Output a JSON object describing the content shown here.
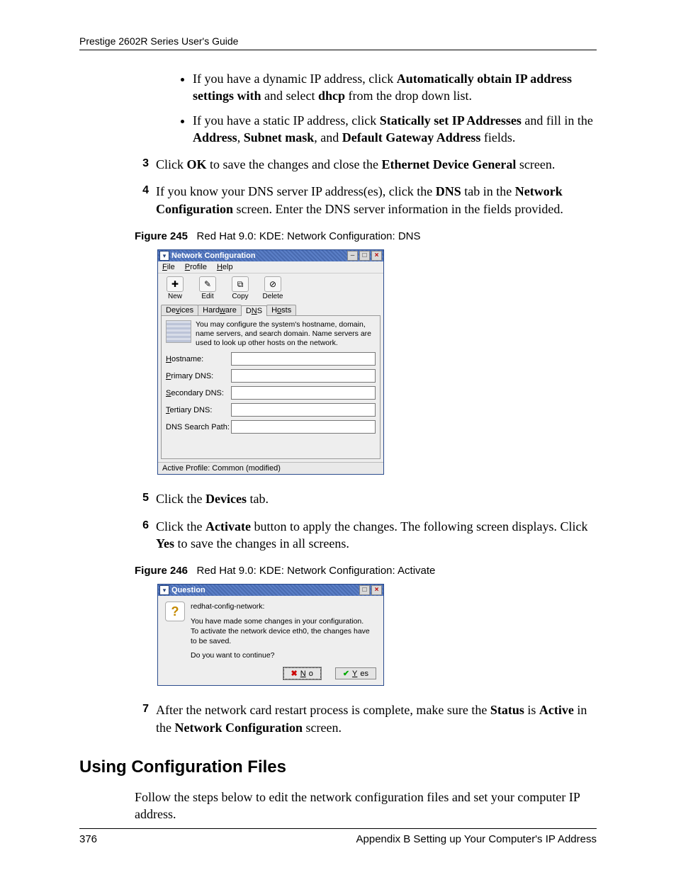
{
  "doc": {
    "header": "Prestige 2602R Series User's Guide",
    "footer_left": "376",
    "footer_right": "Appendix B Setting up Your Computer's IP Address"
  },
  "bullets": {
    "b1": {
      "pre": "If you have a dynamic IP address, click ",
      "b1": "Automatically obtain IP address settings with",
      "mid": " and select ",
      "b2": "dhcp",
      "post": " from the drop down list."
    },
    "b2": {
      "pre": "If you have a static IP address, click ",
      "b1": "Statically set IP Addresses",
      "mid": " and fill in the ",
      "b2": "Address",
      "c": ", ",
      "b3": "Subnet mask",
      "c2": ", and ",
      "b4": "Default Gateway Address",
      "post": " fields."
    }
  },
  "steps": {
    "s3": {
      "n": "3",
      "pre": "Click ",
      "b1": "OK",
      "mid": " to save the changes and close the ",
      "b2": "Ethernet Device General",
      "post": " screen."
    },
    "s4": {
      "n": "4",
      "pre": "If you know your DNS server IP address(es), click the ",
      "b1": "DNS",
      "mid": " tab in the ",
      "b2": "Network Configuration",
      "post": " screen. Enter the DNS server information in the fields provided."
    },
    "s5": {
      "n": "5",
      "pre": "Click the ",
      "b1": "Devices",
      "post": " tab."
    },
    "s6": {
      "n": "6",
      "pre": "Click the ",
      "b1": "Activate",
      "mid": " button to apply the changes. The following screen displays. Click ",
      "b2": "Yes",
      "post": " to save the changes in all screens."
    },
    "s7": {
      "n": "7",
      "pre": "After the network card restart process is complete, make sure the ",
      "b1": "Status",
      "mid": " is ",
      "b2": "Active",
      "mid2": " in the ",
      "b3": "Network Configuration",
      "post": " screen."
    }
  },
  "figs": {
    "f245": {
      "label": "Figure 245",
      "caption": "Red Hat 9.0: KDE: Network Configuration: DNS"
    },
    "f246": {
      "label": "Figure 246",
      "caption": "Red Hat 9.0: KDE: Network Configuration: Activate"
    }
  },
  "section": {
    "heading": "Using Configuration Files",
    "para": "Follow the steps below to edit the network configuration files and set your computer IP address."
  },
  "win245": {
    "title": "Network Configuration",
    "menu": {
      "file": "File",
      "profile": "Profile",
      "help": "Help"
    },
    "tools": {
      "new": "New",
      "edit": "Edit",
      "copy": "Copy",
      "delete": "Delete"
    },
    "tabs": {
      "devices": "Devices",
      "hardware": "Hardware",
      "dns": "DNS",
      "hosts": "Hosts"
    },
    "desc": "You may configure the system's hostname, domain, name servers, and search domain. Name servers are used to look up other hosts on the network.",
    "fields": {
      "hostname": "Hostname:",
      "pdns": "Primary DNS:",
      "sdns": "Secondary DNS:",
      "tdns": "Tertiary DNS:",
      "search": "DNS Search Path:"
    },
    "status": "Active Profile: Common (modified)"
  },
  "dlg246": {
    "title": "Question",
    "line1": "redhat-config-network:",
    "line2": "You have made some changes in your configuration.",
    "line3": "To activate the network device eth0, the changes have to be saved.",
    "line4": "Do you want to continue?",
    "no": "No",
    "yes": "Yes"
  }
}
